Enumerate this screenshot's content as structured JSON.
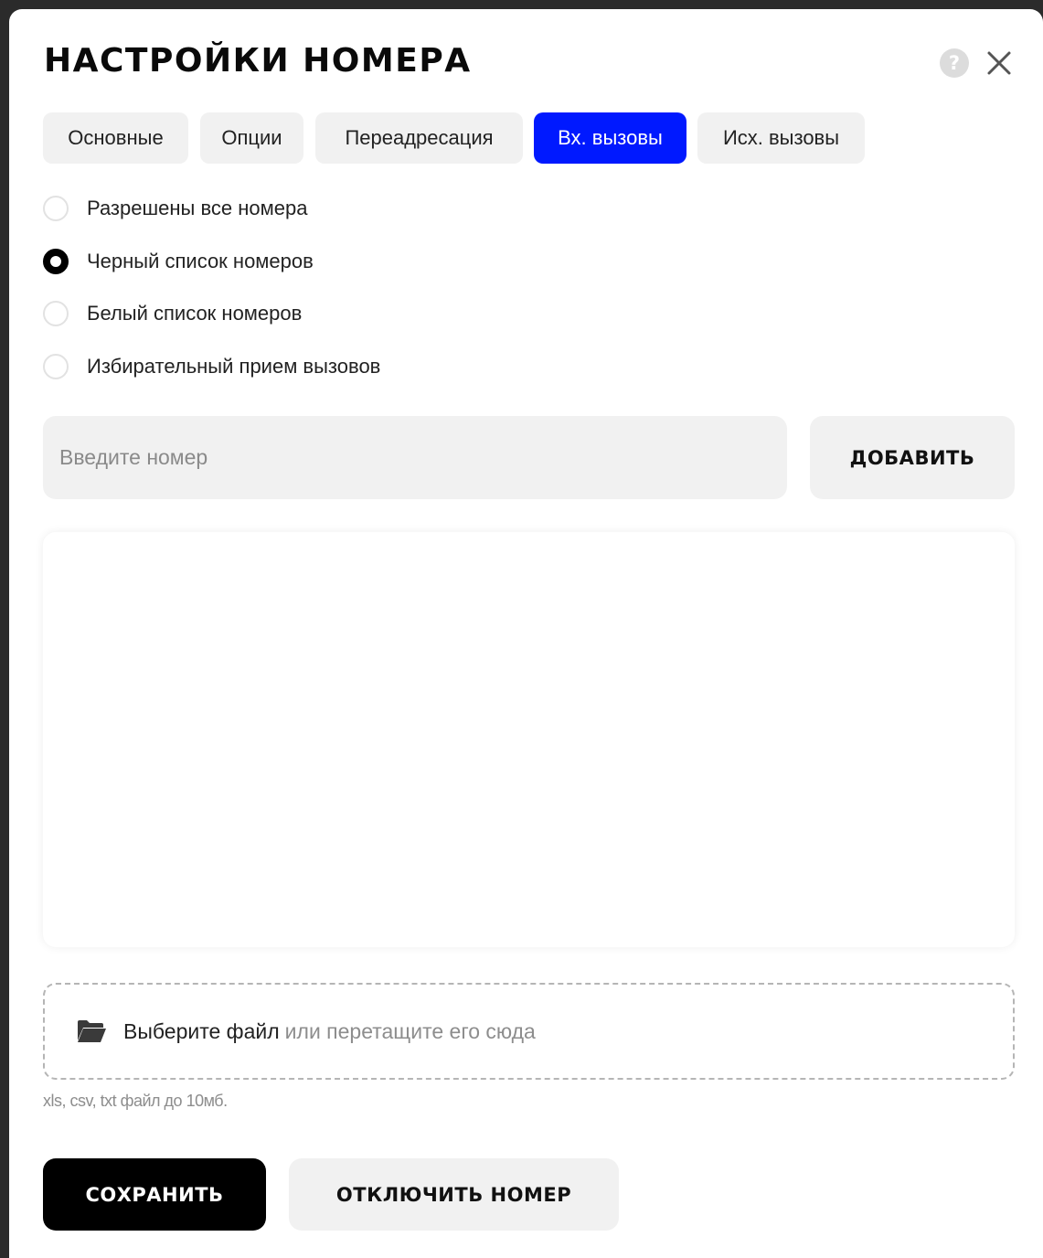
{
  "modal": {
    "title": "НАСТРОЙКИ НОМЕРА",
    "help_icon": "?",
    "help_icon_name": "help-circle-icon",
    "close_icon_name": "close-icon"
  },
  "tabs": [
    {
      "label": "Основные",
      "active": false
    },
    {
      "label": "Опции",
      "active": false
    },
    {
      "label": "Переадресация",
      "active": false
    },
    {
      "label": "Вх. вызовы",
      "active": true
    },
    {
      "label": "Исх. вызовы",
      "active": false
    }
  ],
  "call_filter": {
    "options": [
      {
        "label": "Разрешены все номера",
        "selected": false
      },
      {
        "label": "Черный список номеров",
        "selected": true
      },
      {
        "label": "Белый список номеров",
        "selected": false
      },
      {
        "label": "Избирательный прием вызовов",
        "selected": false
      }
    ]
  },
  "number_entry": {
    "placeholder": "Введите номер",
    "value": "",
    "add_label": "ДОБАВИТЬ"
  },
  "upload": {
    "choose_label": "Выберите файл",
    "drag_label": "или перетащите его сюда",
    "hint": "xls, csv, txt файл до 10мб.",
    "icon_name": "folder-open-icon"
  },
  "actions": {
    "save_label": "СОХРАНИТЬ",
    "disable_label": "ОТКЛЮЧИТЬ НОМЕР"
  },
  "colors": {
    "accent": "#0019ff",
    "primary_button": "#000000",
    "secondary_surface": "#f1f1f1"
  }
}
